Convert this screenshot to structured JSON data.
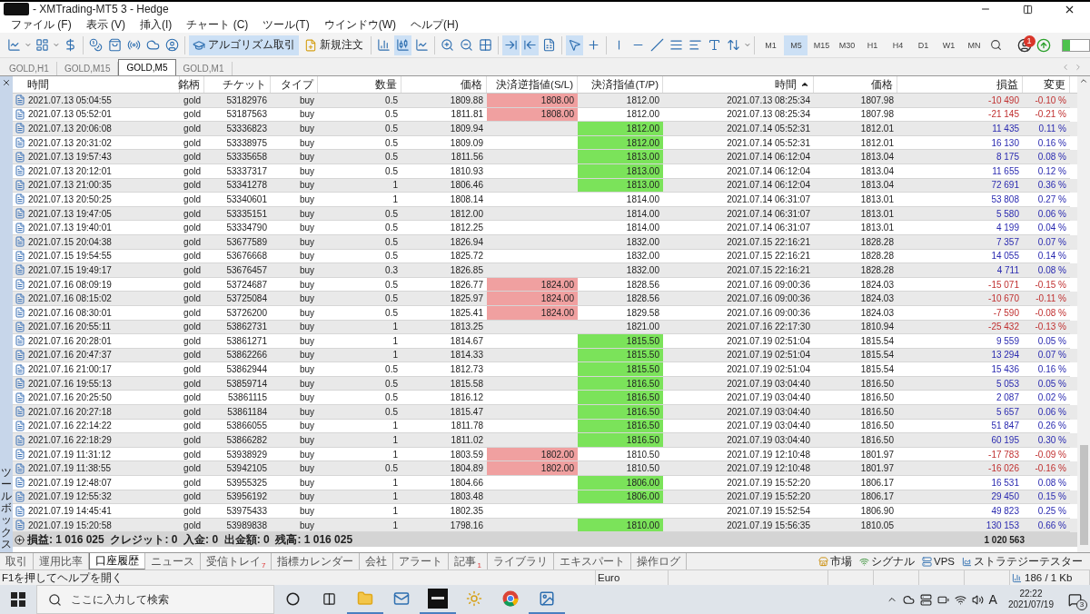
{
  "window": {
    "title": "- XMTrading-MT5 3 - Hedge"
  },
  "menu": [
    "ファイル (F)",
    "表示 (V)",
    "挿入(I)",
    "チャート (C)",
    "ツール(T)",
    "ウインドウ(W)",
    "ヘルプ(H)"
  ],
  "toolbar": {
    "icons_a": [
      {
        "kind": "newchart",
        "on": false
      },
      {
        "kind": "profiles",
        "on": false
      },
      {
        "kind": "money",
        "on": false
      },
      {
        "kind": "coins",
        "on": false
      },
      {
        "kind": "bag",
        "on": false
      },
      {
        "kind": "signal",
        "on": false
      },
      {
        "kind": "cloud",
        "on": false
      },
      {
        "kind": "person",
        "on": false
      }
    ],
    "algo": {
      "label": "アルゴリズム取引",
      "on": true
    },
    "order": {
      "label": "新規注文"
    },
    "icons_b": [
      {
        "kind": "bars",
        "on": false
      },
      {
        "kind": "candles",
        "on": true
      },
      {
        "kind": "line",
        "on": false
      },
      {
        "kind": "zoomin",
        "on": false
      },
      {
        "kind": "zoomout",
        "on": false
      },
      {
        "kind": "grid",
        "on": false
      },
      {
        "kind": "scroll",
        "on": true
      },
      {
        "kind": "shift",
        "on": true
      },
      {
        "kind": "template",
        "on": false
      },
      {
        "kind": "cursor",
        "on": true
      },
      {
        "kind": "crosshair",
        "on": false
      },
      {
        "kind": "vline",
        "on": false
      },
      {
        "kind": "hline",
        "on": false
      },
      {
        "kind": "trend",
        "on": false
      },
      {
        "kind": "fibo",
        "on": false
      },
      {
        "kind": "channels",
        "on": false
      },
      {
        "kind": "text",
        "on": false
      },
      {
        "kind": "arrows",
        "on": false
      }
    ],
    "timeframes": [
      {
        "label": "M1",
        "selected": false
      },
      {
        "label": "M5",
        "selected": true
      },
      {
        "label": "M15",
        "selected": false
      },
      {
        "label": "M30",
        "selected": false
      },
      {
        "label": "H1",
        "selected": false
      },
      {
        "label": "H4",
        "selected": false
      },
      {
        "label": "D1",
        "selected": false
      },
      {
        "label": "W1",
        "selected": false
      },
      {
        "label": "MN",
        "selected": false
      }
    ],
    "notification_count": "1",
    "connection": {
      "level": 0.3
    }
  },
  "chart_tabs": [
    {
      "label": "GOLD,H1",
      "selected": false
    },
    {
      "label": "GOLD,M15",
      "selected": false
    },
    {
      "label": "GOLD,M5",
      "selected": true
    },
    {
      "label": "GOLD,M1",
      "selected": false
    }
  ],
  "table": {
    "columns": [
      {
        "label": "時間",
        "sorted": false
      },
      {
        "label": "銘柄",
        "sorted": false
      },
      {
        "label": "チケット",
        "sorted": false
      },
      {
        "label": "タイプ",
        "sorted": false
      },
      {
        "label": "数量",
        "sorted": false
      },
      {
        "label": "価格",
        "sorted": false
      },
      {
        "label": "決済逆指値(S/L)",
        "sorted": false
      },
      {
        "label": "決済指値(T/P)",
        "sorted": false
      },
      {
        "label": "時間",
        "sorted": true
      },
      {
        "label": "価格",
        "sorted": false
      },
      {
        "label": "損益",
        "sorted": false
      },
      {
        "label": "変更",
        "sorted": false
      }
    ],
    "rows": [
      {
        "open_time": "2021.07.13 05:04:55",
        "symbol": "gold",
        "ticket": "53182976",
        "type": "buy",
        "volume": "0.5",
        "price": "1809.88",
        "sl": "1808.00",
        "tp": "1812.00",
        "close_time": "2021.07.13 08:25:34",
        "close_price": "1807.98",
        "profit": "-10 490",
        "change": "-0.10 %",
        "sl_hit": true,
        "tp_hit": false,
        "loss": true
      },
      {
        "open_time": "2021.07.13 05:52:01",
        "symbol": "gold",
        "ticket": "53187563",
        "type": "buy",
        "volume": "0.5",
        "price": "1811.81",
        "sl": "1808.00",
        "tp": "1812.00",
        "close_time": "2021.07.13 08:25:34",
        "close_price": "1807.98",
        "profit": "-21 145",
        "change": "-0.21 %",
        "sl_hit": true,
        "tp_hit": false,
        "loss": true
      },
      {
        "open_time": "2021.07.13 20:06:08",
        "symbol": "gold",
        "ticket": "53336823",
        "type": "buy",
        "volume": "0.5",
        "price": "1809.94",
        "tp": "1812.00",
        "close_time": "2021.07.14 05:52:31",
        "close_price": "1812.01",
        "profit": "11 435",
        "change": "0.11 %",
        "sl_hit": false,
        "tp_hit": true,
        "loss": false
      },
      {
        "open_time": "2021.07.13 20:31:02",
        "symbol": "gold",
        "ticket": "53338975",
        "type": "buy",
        "volume": "0.5",
        "price": "1809.09",
        "tp": "1812.00",
        "close_time": "2021.07.14 05:52:31",
        "close_price": "1812.01",
        "profit": "16 130",
        "change": "0.16 %",
        "sl_hit": false,
        "tp_hit": true,
        "loss": false
      },
      {
        "open_time": "2021.07.13 19:57:43",
        "symbol": "gold",
        "ticket": "53335658",
        "type": "buy",
        "volume": "0.5",
        "price": "1811.56",
        "tp": "1813.00",
        "close_time": "2021.07.14 06:12:04",
        "close_price": "1813.04",
        "profit": "8 175",
        "change": "0.08 %",
        "sl_hit": false,
        "tp_hit": true,
        "loss": false
      },
      {
        "open_time": "2021.07.13 20:12:01",
        "symbol": "gold",
        "ticket": "53337317",
        "type": "buy",
        "volume": "0.5",
        "price": "1810.93",
        "tp": "1813.00",
        "close_time": "2021.07.14 06:12:04",
        "close_price": "1813.04",
        "profit": "11 655",
        "change": "0.12 %",
        "sl_hit": false,
        "tp_hit": true,
        "loss": false
      },
      {
        "open_time": "2021.07.13 21:00:35",
        "symbol": "gold",
        "ticket": "53341278",
        "type": "buy",
        "volume": "1",
        "price": "1806.46",
        "tp": "1813.00",
        "close_time": "2021.07.14 06:12:04",
        "close_price": "1813.04",
        "profit": "72 691",
        "change": "0.36 %",
        "sl_hit": false,
        "tp_hit": true,
        "loss": false
      },
      {
        "open_time": "2021.07.13 20:50:25",
        "symbol": "gold",
        "ticket": "53340601",
        "type": "buy",
        "volume": "1",
        "price": "1808.14",
        "tp": "1814.00",
        "close_time": "2021.07.14 06:31:07",
        "close_price": "1813.01",
        "profit": "53 808",
        "change": "0.27 %",
        "sl_hit": false,
        "tp_hit": false,
        "loss": false
      },
      {
        "open_time": "2021.07.13 19:47:05",
        "symbol": "gold",
        "ticket": "53335151",
        "type": "buy",
        "volume": "0.5",
        "price": "1812.00",
        "tp": "1814.00",
        "close_time": "2021.07.14 06:31:07",
        "close_price": "1813.01",
        "profit": "5 580",
        "change": "0.06 %",
        "sl_hit": false,
        "tp_hit": false,
        "loss": false
      },
      {
        "open_time": "2021.07.13 19:40:01",
        "symbol": "gold",
        "ticket": "53334790",
        "type": "buy",
        "volume": "0.5",
        "price": "1812.25",
        "tp": "1814.00",
        "close_time": "2021.07.14 06:31:07",
        "close_price": "1813.01",
        "profit": "4 199",
        "change": "0.04 %",
        "sl_hit": false,
        "tp_hit": false,
        "loss": false
      },
      {
        "open_time": "2021.07.15 20:04:38",
        "symbol": "gold",
        "ticket": "53677589",
        "type": "buy",
        "volume": "0.5",
        "price": "1826.94",
        "tp": "1832.00",
        "close_time": "2021.07.15 22:16:21",
        "close_price": "1828.28",
        "profit": "7 357",
        "change": "0.07 %",
        "sl_hit": false,
        "tp_hit": false,
        "loss": false
      },
      {
        "open_time": "2021.07.15 19:54:55",
        "symbol": "gold",
        "ticket": "53676668",
        "type": "buy",
        "volume": "0.5",
        "price": "1825.72",
        "tp": "1832.00",
        "close_time": "2021.07.15 22:16:21",
        "close_price": "1828.28",
        "profit": "14 055",
        "change": "0.14 %",
        "sl_hit": false,
        "tp_hit": false,
        "loss": false
      },
      {
        "open_time": "2021.07.15 19:49:17",
        "symbol": "gold",
        "ticket": "53676457",
        "type": "buy",
        "volume": "0.3",
        "price": "1826.85",
        "tp": "1832.00",
        "close_time": "2021.07.15 22:16:21",
        "close_price": "1828.28",
        "profit": "4 711",
        "change": "0.08 %",
        "sl_hit": false,
        "tp_hit": false,
        "loss": false
      },
      {
        "open_time": "2021.07.16 08:09:19",
        "symbol": "gold",
        "ticket": "53724687",
        "type": "buy",
        "volume": "0.5",
        "price": "1826.77",
        "sl": "1824.00",
        "tp": "1828.56",
        "close_time": "2021.07.16 09:00:36",
        "close_price": "1824.03",
        "profit": "-15 071",
        "change": "-0.15 %",
        "sl_hit": true,
        "tp_hit": false,
        "loss": true
      },
      {
        "open_time": "2021.07.16 08:15:02",
        "symbol": "gold",
        "ticket": "53725084",
        "type": "buy",
        "volume": "0.5",
        "price": "1825.97",
        "sl": "1824.00",
        "tp": "1828.56",
        "close_time": "2021.07.16 09:00:36",
        "close_price": "1824.03",
        "profit": "-10 670",
        "change": "-0.11 %",
        "sl_hit": true,
        "tp_hit": false,
        "loss": true
      },
      {
        "open_time": "2021.07.16 08:30:01",
        "symbol": "gold",
        "ticket": "53726200",
        "type": "buy",
        "volume": "0.5",
        "price": "1825.41",
        "sl": "1824.00",
        "tp": "1829.58",
        "close_time": "2021.07.16 09:00:36",
        "close_price": "1824.03",
        "profit": "-7 590",
        "change": "-0.08 %",
        "sl_hit": true,
        "tp_hit": false,
        "loss": true
      },
      {
        "open_time": "2021.07.16 20:55:11",
        "symbol": "gold",
        "ticket": "53862731",
        "type": "buy",
        "volume": "1",
        "price": "1813.25",
        "tp": "1821.00",
        "close_time": "2021.07.16 22:17:30",
        "close_price": "1810.94",
        "profit": "-25 432",
        "change": "-0.13 %",
        "sl_hit": false,
        "tp_hit": false,
        "loss": true
      },
      {
        "open_time": "2021.07.16 20:28:01",
        "symbol": "gold",
        "ticket": "53861271",
        "type": "buy",
        "volume": "1",
        "price": "1814.67",
        "tp": "1815.50",
        "close_time": "2021.07.19 02:51:04",
        "close_price": "1815.54",
        "profit": "9 559",
        "change": "0.05 %",
        "sl_hit": false,
        "tp_hit": true,
        "loss": false
      },
      {
        "open_time": "2021.07.16 20:47:37",
        "symbol": "gold",
        "ticket": "53862266",
        "type": "buy",
        "volume": "1",
        "price": "1814.33",
        "tp": "1815.50",
        "close_time": "2021.07.19 02:51:04",
        "close_price": "1815.54",
        "profit": "13 294",
        "change": "0.07 %",
        "sl_hit": false,
        "tp_hit": true,
        "loss": false
      },
      {
        "open_time": "2021.07.16 21:00:17",
        "symbol": "gold",
        "ticket": "53862944",
        "type": "buy",
        "volume": "0.5",
        "price": "1812.73",
        "tp": "1815.50",
        "close_time": "2021.07.19 02:51:04",
        "close_price": "1815.54",
        "profit": "15 436",
        "change": "0.16 %",
        "sl_hit": false,
        "tp_hit": true,
        "loss": false
      },
      {
        "open_time": "2021.07.16 19:55:13",
        "symbol": "gold",
        "ticket": "53859714",
        "type": "buy",
        "volume": "0.5",
        "price": "1815.58",
        "tp": "1816.50",
        "close_time": "2021.07.19 03:04:40",
        "close_price": "1816.50",
        "profit": "5 053",
        "change": "0.05 %",
        "sl_hit": false,
        "tp_hit": true,
        "loss": false
      },
      {
        "open_time": "2021.07.16 20:25:50",
        "symbol": "gold",
        "ticket": "53861115",
        "type": "buy",
        "volume": "0.5",
        "price": "1816.12",
        "tp": "1816.50",
        "close_time": "2021.07.19 03:04:40",
        "close_price": "1816.50",
        "profit": "2 087",
        "change": "0.02 %",
        "sl_hit": false,
        "tp_hit": true,
        "loss": false
      },
      {
        "open_time": "2021.07.16 20:27:18",
        "symbol": "gold",
        "ticket": "53861184",
        "type": "buy",
        "volume": "0.5",
        "price": "1815.47",
        "tp": "1816.50",
        "close_time": "2021.07.19 03:04:40",
        "close_price": "1816.50",
        "profit": "5 657",
        "change": "0.06 %",
        "sl_hit": false,
        "tp_hit": true,
        "loss": false
      },
      {
        "open_time": "2021.07.16 22:14:22",
        "symbol": "gold",
        "ticket": "53866055",
        "type": "buy",
        "volume": "1",
        "price": "1811.78",
        "tp": "1816.50",
        "close_time": "2021.07.19 03:04:40",
        "close_price": "1816.50",
        "profit": "51 847",
        "change": "0.26 %",
        "sl_hit": false,
        "tp_hit": true,
        "loss": false
      },
      {
        "open_time": "2021.07.16 22:18:29",
        "symbol": "gold",
        "ticket": "53866282",
        "type": "buy",
        "volume": "1",
        "price": "1811.02",
        "tp": "1816.50",
        "close_time": "2021.07.19 03:04:40",
        "close_price": "1816.50",
        "profit": "60 195",
        "change": "0.30 %",
        "sl_hit": false,
        "tp_hit": true,
        "loss": false
      },
      {
        "open_time": "2021.07.19 11:31:12",
        "symbol": "gold",
        "ticket": "53938929",
        "type": "buy",
        "volume": "1",
        "price": "1803.59",
        "sl": "1802.00",
        "tp": "1810.50",
        "close_time": "2021.07.19 12:10:48",
        "close_price": "1801.97",
        "profit": "-17 783",
        "change": "-0.09 %",
        "sl_hit": true,
        "tp_hit": false,
        "loss": true
      },
      {
        "open_time": "2021.07.19 11:38:55",
        "symbol": "gold",
        "ticket": "53942105",
        "type": "buy",
        "volume": "0.5",
        "price": "1804.89",
        "sl": "1802.00",
        "tp": "1810.50",
        "close_time": "2021.07.19 12:10:48",
        "close_price": "1801.97",
        "profit": "-16 026",
        "change": "-0.16 %",
        "sl_hit": true,
        "tp_hit": false,
        "loss": true
      },
      {
        "open_time": "2021.07.19 12:48:07",
        "symbol": "gold",
        "ticket": "53955325",
        "type": "buy",
        "volume": "1",
        "price": "1804.66",
        "tp": "1806.00",
        "close_time": "2021.07.19 15:52:20",
        "close_price": "1806.17",
        "profit": "16 531",
        "change": "0.08 %",
        "sl_hit": false,
        "tp_hit": true,
        "loss": false
      },
      {
        "open_time": "2021.07.19 12:55:32",
        "symbol": "gold",
        "ticket": "53956192",
        "type": "buy",
        "volume": "1",
        "price": "1803.48",
        "tp": "1806.00",
        "close_time": "2021.07.19 15:52:20",
        "close_price": "1806.17",
        "profit": "29 450",
        "change": "0.15 %",
        "sl_hit": false,
        "tp_hit": true,
        "loss": false
      },
      {
        "open_time": "2021.07.19 14:45:41",
        "symbol": "gold",
        "ticket": "53975433",
        "type": "buy",
        "volume": "1",
        "price": "1802.35",
        "close_time": "2021.07.19 15:52:54",
        "close_price": "1806.90",
        "profit": "49 823",
        "change": "0.25 %",
        "sl_hit": false,
        "tp_hit": false,
        "loss": false
      },
      {
        "open_time": "2021.07.19 15:20:58",
        "symbol": "gold",
        "ticket": "53989838",
        "type": "buy",
        "volume": "1",
        "price": "1798.16",
        "tp": "1810.00",
        "close_time": "2021.07.19 15:56:35",
        "close_price": "1810.05",
        "profit": "130 153",
        "change": "0.66 %",
        "sl_hit": false,
        "tp_hit": true,
        "loss": false
      }
    ],
    "summary": "損益: 1 016 025  クレジット: 0  入金: 0  出金額: 0  残高: 1 016 025",
    "summary_total": "1 020 563"
  },
  "toolbox_label": "ツールボックス",
  "bottom_tabs": [
    {
      "label": "取引",
      "selected": false
    },
    {
      "label": "運用比率",
      "selected": false
    },
    {
      "label": "口座履歴",
      "selected": true
    },
    {
      "label": "ニュース",
      "selected": false
    },
    {
      "label": "受信トレイ",
      "badge": "7",
      "selected": false
    },
    {
      "label": "指標カレンダー",
      "selected": false
    },
    {
      "label": "会社",
      "selected": false
    },
    {
      "label": "アラート",
      "selected": false
    },
    {
      "label": "記事",
      "badge": "1",
      "selected": false
    },
    {
      "label": "ライブラリ",
      "selected": false
    },
    {
      "label": "エキスパート",
      "selected": false
    },
    {
      "label": "操作ログ",
      "selected": false
    }
  ],
  "bottom_links": [
    {
      "kind": "market",
      "label": "市場"
    },
    {
      "kind": "signals",
      "label": "シグナル"
    },
    {
      "kind": "vps",
      "label": "VPS"
    },
    {
      "kind": "tester",
      "label": "ストラテジーテスター"
    }
  ],
  "status_bar": {
    "help": "F1を押してヘルプを開く",
    "currency": "Euro",
    "traffic": "186 / 1 Kb"
  },
  "taskbar": {
    "search_placeholder": "ここに入力して検索",
    "ime": "A",
    "time": "22:22",
    "date": "2021/07/19",
    "notifications": "3"
  }
}
